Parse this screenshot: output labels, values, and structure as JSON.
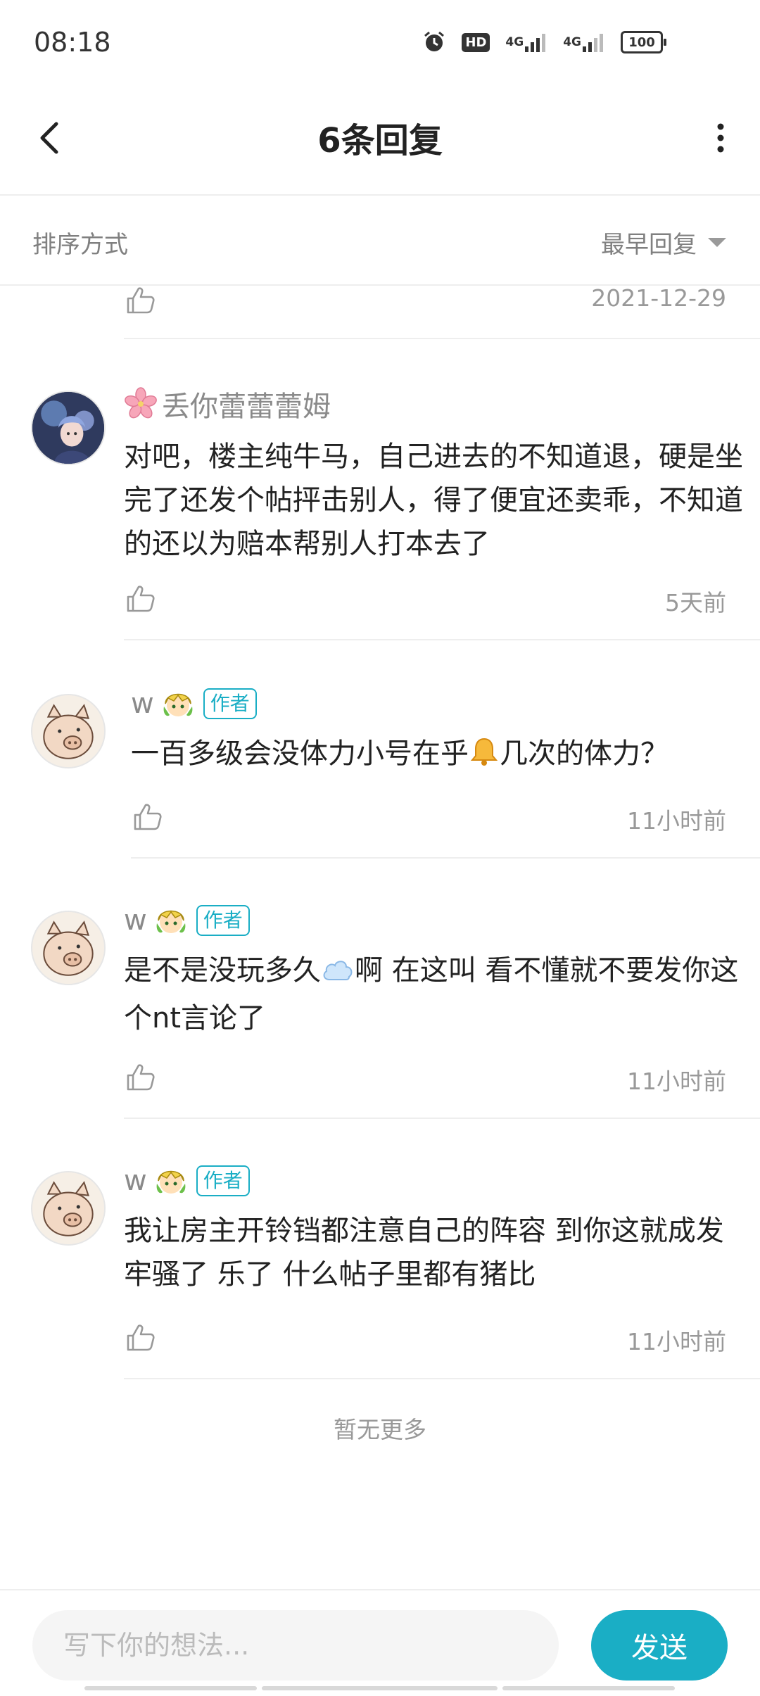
{
  "status_bar": {
    "time": "08:18",
    "hd_label": "HD",
    "network_1": "4G",
    "network_2": "4G",
    "battery": "100"
  },
  "header": {
    "title": "6条回复"
  },
  "sort": {
    "label": "排序方式",
    "selected": "最早回复"
  },
  "partial_reply": {
    "time": "2021-12-29"
  },
  "comments": [
    {
      "username": "丢你蕾蕾蕾姆",
      "text": "对吧，楼主纯牛马，自己进去的不知道退，硬是坐完了还发个帖抨击别人，得了便宜还卖乖，不知道的还以为赔本帮别人打本去了",
      "time": "5天前"
    },
    {
      "username": "w",
      "tag": "作者",
      "text_before": "一百多级会没体力小号在乎",
      "text_after": "几次的体力？",
      "time": "11小时前"
    },
    {
      "username": "w",
      "tag": "作者",
      "text_before": "是不是没玩多久",
      "text_after": "啊 在这叫 看不懂就不要发你这个nt言论了",
      "time": "11小时前"
    },
    {
      "username": "w",
      "tag": "作者",
      "text": "我让房主开铃铛都注意自己的阵容 到你这就成发牢骚了 乐了 什么帖子里都有猪比",
      "time": "11小时前"
    }
  ],
  "footer": {
    "no_more": "暂无更多"
  },
  "input": {
    "placeholder": "写下你的想法...",
    "send_label": "发送"
  },
  "colors": {
    "accent": "#1aaec5",
    "secondary_text": "#999999"
  },
  "icons": [
    "back-icon",
    "more-icon",
    "like-icon",
    "alarm-icon",
    "signal-icon",
    "battery-icon",
    "bell-emoji",
    "cloud-emoji",
    "cherry-blossom-icon"
  ]
}
